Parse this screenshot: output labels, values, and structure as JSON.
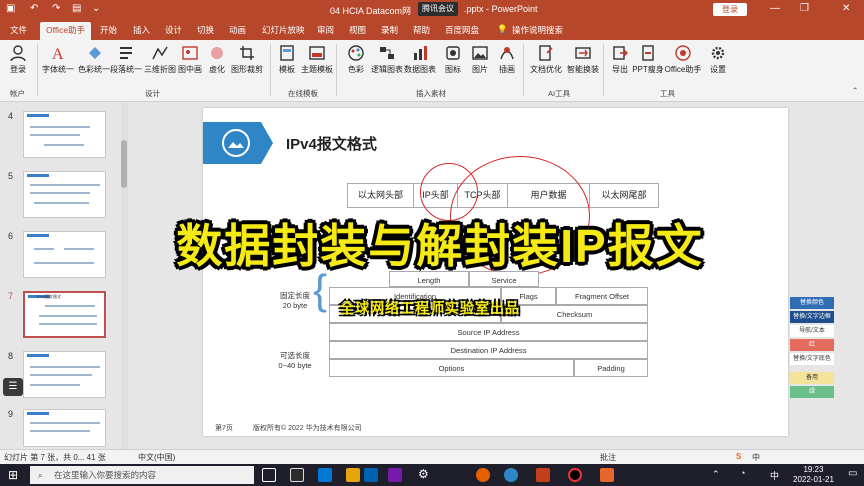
{
  "titlebar": {
    "document_title": "04 HCIA Datacom网",
    "document_title_tail": ".pptx  -  PowerPoint",
    "meeting": "腾讯会议",
    "login": "登录",
    "min": "—",
    "restore": "❐",
    "close": "✕"
  },
  "tabs": [
    "文件",
    "Office助手",
    "开始",
    "插入",
    "设计",
    "切换",
    "动画",
    "幻灯片放映",
    "审阅",
    "视图",
    "录制",
    "帮助",
    "百度网盘",
    "操作说明搜索"
  ],
  "ribbon": {
    "buttons": [
      "登录",
      "字体统一",
      "色彩统一",
      "段落统一",
      "三维折图",
      "图中画",
      "虚化",
      "图形裁剪",
      "模板",
      "主题模板",
      "色彩",
      "逻辑图表",
      "数据图表",
      "图标",
      "图片",
      "插画",
      "文档优化",
      "智能换装",
      "导出",
      "PPT瘦身",
      "Office助手",
      "设置"
    ],
    "groups": [
      "帐户",
      "设计",
      "在线模板",
      "插入素材",
      "AI工具",
      "工具"
    ]
  },
  "thumbnails": {
    "numbers": [
      "4",
      "5",
      "6",
      "7",
      "8",
      "9"
    ],
    "selected": "7",
    "selected_caption": "IPv4报文格式"
  },
  "slide": {
    "title": "IPv4报文格式",
    "frame_fields": [
      "以太网头部",
      "IP头部",
      "TCP头部",
      "用户数据",
      "以太网尾部"
    ],
    "ip_header": {
      "row1": [
        "Length",
        "Service"
      ],
      "row2": [
        "Identification",
        "Flags",
        "Fragment Offset"
      ],
      "row3_right": "Checksum",
      "row4": "Source IP Address",
      "row5": "Destination IP Address",
      "row6": [
        "Options",
        "Padding"
      ]
    },
    "fixed_label": "固定长度",
    "fixed_value": "20 byte",
    "optional_label": "可选长度",
    "optional_value": "0~40 byte",
    "page_no": "第7页",
    "copyright": "版权所有© 2022 华为技术有限公司"
  },
  "overlay": {
    "headline": "数据封装与解封装IP报文",
    "credit": "全球网络工程师实验室出品"
  },
  "right_panel": {
    "items": [
      "替换颜色",
      "替换/文字边框",
      "导航/文本",
      "红",
      "替换/文字底色",
      "备用",
      "绿"
    ]
  },
  "statusbar": {
    "slide_info": "幻灯片 第 7 张，共 0... 41 张",
    "language": "中文(中国)",
    "notes": "批注"
  },
  "taskbar": {
    "search_placeholder": "在这里输入你要搜索的内容",
    "time": "19:23",
    "date": "2022-01-21",
    "ime": "中"
  },
  "colors": {
    "accent": "#b7472a",
    "slide_blue": "#2f86c6",
    "overlay_yellow": "#f5ea13"
  }
}
